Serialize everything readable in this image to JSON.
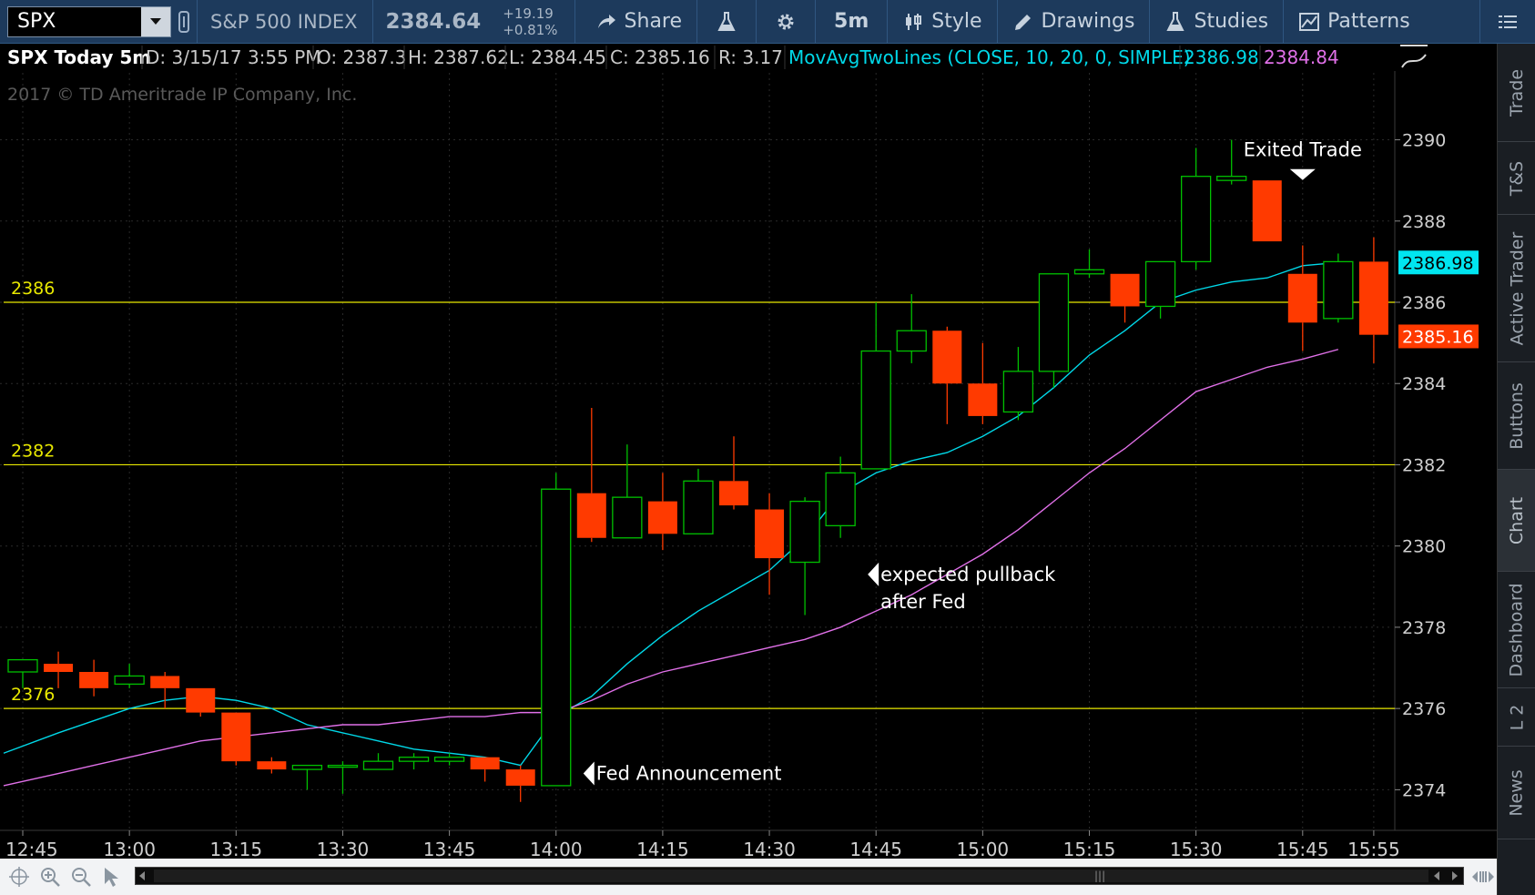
{
  "toolbar": {
    "symbol": "SPX",
    "index_name": "S&P 500 INDEX",
    "last_price": "2384.64",
    "change_points": "+19.19",
    "change_percent": "+0.81%",
    "share_label": "Share",
    "timeframe_label": "5m",
    "style_label": "Style",
    "drawings_label": "Drawings",
    "studies_label": "Studies",
    "patterns_label": "Patterns"
  },
  "header": {
    "title": "SPX Today 5m",
    "date": "D: 3/15/17 3:55 PM",
    "open": "O: 2387.3",
    "high": "H: 2387.62",
    "low": "L: 2384.45",
    "close": "C: 2385.16",
    "range": "R: 3.17",
    "study_label": "MovAvgTwoLines (CLOSE, 10, 20, 0, SIMPLE)",
    "study_value_1": "2386.98",
    "study_value_2": "2384.84",
    "copyright": "2017 © TD Ameritrade IP Company, Inc."
  },
  "side_tabs": [
    "Trade",
    "T&S",
    "Active Trader",
    "Buttons",
    "Chart",
    "Dashboard",
    "L 2",
    "News"
  ],
  "side_tabs_active": "Chart",
  "chart_data": {
    "type": "candlestick",
    "y_range": [
      2373,
      2391.2
    ],
    "y_ticks": [
      2374,
      2376,
      2378,
      2380,
      2382,
      2384,
      2386,
      2388,
      2390
    ],
    "x_ticks": [
      {
        "label": "12:45",
        "bar": 0
      },
      {
        "label": "13:00",
        "bar": 3
      },
      {
        "label": "13:15",
        "bar": 6
      },
      {
        "label": "13:30",
        "bar": 9
      },
      {
        "label": "13:45",
        "bar": 12
      },
      {
        "label": "14:00",
        "bar": 15
      },
      {
        "label": "14:15",
        "bar": 18
      },
      {
        "label": "14:30",
        "bar": 21
      },
      {
        "label": "14:45",
        "bar": 24
      },
      {
        "label": "15:00",
        "bar": 27
      },
      {
        "label": "15:15",
        "bar": 30
      },
      {
        "label": "15:30",
        "bar": 33
      },
      {
        "label": "15:45",
        "bar": 36
      },
      {
        "label": "15:55",
        "bar": 38
      }
    ],
    "candles": [
      {
        "o": 2376.9,
        "h": 2377.2,
        "l": 2376.5,
        "c": 2377.2
      },
      {
        "o": 2377.1,
        "h": 2377.4,
        "l": 2376.5,
        "c": 2376.9
      },
      {
        "o": 2376.9,
        "h": 2377.2,
        "l": 2376.3,
        "c": 2376.5
      },
      {
        "o": 2376.6,
        "h": 2377.1,
        "l": 2376.5,
        "c": 2376.8
      },
      {
        "o": 2376.8,
        "h": 2376.9,
        "l": 2376.0,
        "c": 2376.5
      },
      {
        "o": 2376.5,
        "h": 2376.5,
        "l": 2375.8,
        "c": 2375.9
      },
      {
        "o": 2375.9,
        "h": 2375.9,
        "l": 2374.6,
        "c": 2374.7
      },
      {
        "o": 2374.7,
        "h": 2374.8,
        "l": 2374.4,
        "c": 2374.5
      },
      {
        "o": 2374.5,
        "h": 2374.6,
        "l": 2374.0,
        "c": 2374.6
      },
      {
        "o": 2374.6,
        "h": 2374.7,
        "l": 2373.9,
        "c": 2374.6
      },
      {
        "o": 2374.5,
        "h": 2374.9,
        "l": 2374.5,
        "c": 2374.7
      },
      {
        "o": 2374.7,
        "h": 2374.9,
        "l": 2374.5,
        "c": 2374.8
      },
      {
        "o": 2374.7,
        "h": 2374.9,
        "l": 2374.6,
        "c": 2374.8
      },
      {
        "o": 2374.8,
        "h": 2374.8,
        "l": 2374.2,
        "c": 2374.5
      },
      {
        "o": 2374.5,
        "h": 2374.6,
        "l": 2373.7,
        "c": 2374.1
      },
      {
        "o": 2374.1,
        "h": 2381.8,
        "l": 2374.1,
        "c": 2381.4
      },
      {
        "o": 2381.3,
        "h": 2383.4,
        "l": 2380.1,
        "c": 2380.2
      },
      {
        "o": 2380.2,
        "h": 2382.5,
        "l": 2380.2,
        "c": 2381.2
      },
      {
        "o": 2381.1,
        "h": 2381.8,
        "l": 2379.9,
        "c": 2380.3
      },
      {
        "o": 2380.3,
        "h": 2381.9,
        "l": 2380.3,
        "c": 2381.6
      },
      {
        "o": 2381.6,
        "h": 2382.7,
        "l": 2380.9,
        "c": 2381.0
      },
      {
        "o": 2380.9,
        "h": 2381.3,
        "l": 2378.8,
        "c": 2379.7
      },
      {
        "o": 2379.6,
        "h": 2381.2,
        "l": 2378.3,
        "c": 2381.1
      },
      {
        "o": 2380.5,
        "h": 2382.2,
        "l": 2380.2,
        "c": 2381.8
      },
      {
        "o": 2381.9,
        "h": 2386.0,
        "l": 2381.9,
        "c": 2384.8
      },
      {
        "o": 2384.8,
        "h": 2386.2,
        "l": 2384.5,
        "c": 2385.3
      },
      {
        "o": 2385.3,
        "h": 2385.4,
        "l": 2383.0,
        "c": 2384.0
      },
      {
        "o": 2384.0,
        "h": 2385.0,
        "l": 2383.0,
        "c": 2383.2
      },
      {
        "o": 2383.3,
        "h": 2384.9,
        "l": 2383.1,
        "c": 2384.3
      },
      {
        "o": 2384.3,
        "h": 2386.7,
        "l": 2383.9,
        "c": 2386.7
      },
      {
        "o": 2386.7,
        "h": 2387.3,
        "l": 2386.6,
        "c": 2386.8
      },
      {
        "o": 2386.7,
        "h": 2386.7,
        "l": 2385.5,
        "c": 2385.9
      },
      {
        "o": 2385.9,
        "h": 2387.0,
        "l": 2385.6,
        "c": 2387.0
      },
      {
        "o": 2387.0,
        "h": 2389.8,
        "l": 2386.8,
        "c": 2389.1
      },
      {
        "o": 2389.0,
        "h": 2390.0,
        "l": 2388.9,
        "c": 2389.1
      },
      {
        "o": 2389.0,
        "h": 2389.0,
        "l": 2387.5,
        "c": 2387.5
      },
      {
        "o": 2386.7,
        "h": 2387.4,
        "l": 2384.8,
        "c": 2385.5
      },
      {
        "o": 2385.6,
        "h": 2387.2,
        "l": 2385.5,
        "c": 2387.0
      },
      {
        "o": 2387.0,
        "h": 2387.6,
        "l": 2384.5,
        "c": 2385.2
      }
    ],
    "series": [
      {
        "name": "MovAvg 10",
        "color": "#00d8e8",
        "values": [
          2374.9,
          2375.4,
          2375.7,
          2376.0,
          2376.2,
          2376.3,
          2376.2,
          2376.0,
          2375.6,
          2375.4,
          2375.2,
          2375.0,
          2374.9,
          2374.8,
          2374.6,
          2375.8,
          2376.3,
          2377.1,
          2377.8,
          2378.4,
          2378.9,
          2379.4,
          2380.2,
          2381.3,
          2381.8,
          2382.1,
          2382.3,
          2382.7,
          2383.2,
          2383.9,
          2384.7,
          2385.3,
          2386.0,
          2386.3,
          2386.5,
          2386.6,
          2386.9,
          2386.98
        ]
      },
      {
        "name": "MovAvg 20",
        "color": "#e070e8",
        "values": [
          2374.1,
          2374.4,
          2374.6,
          2374.8,
          2375.0,
          2375.2,
          2375.3,
          2375.4,
          2375.5,
          2375.6,
          2375.6,
          2375.7,
          2375.8,
          2375.8,
          2375.9,
          2375.9,
          2376.2,
          2376.6,
          2376.9,
          2377.1,
          2377.3,
          2377.5,
          2377.7,
          2378.0,
          2378.4,
          2378.8,
          2379.3,
          2379.8,
          2380.4,
          2381.1,
          2381.8,
          2382.4,
          2383.1,
          2383.8,
          2384.1,
          2384.4,
          2384.6,
          2384.84
        ]
      }
    ],
    "hlines": [
      {
        "label": "2386",
        "value": 2386.0,
        "color": "#e8e800"
      },
      {
        "label": "2382",
        "value": 2382.0,
        "color": "#e8e800"
      },
      {
        "label": "2376",
        "value": 2376.0,
        "color": "#e8e800"
      }
    ],
    "price_bubbles": [
      {
        "label": "2386.98",
        "value": 2386.98,
        "bg": "#00e5f0",
        "fg": "#000000"
      },
      {
        "label": "2385.16",
        "value": 2385.16,
        "bg": "#ff3a00",
        "fg": "#ffffff"
      }
    ],
    "annotations": [
      {
        "text": "Fed Announcement",
        "bar": 15,
        "value": 2374.4,
        "arrow": "left"
      },
      {
        "text": "expected pullback",
        "text2": "after Fed",
        "bar": 23,
        "value": 2379.3,
        "arrow": "left"
      },
      {
        "text": "Exited Trade",
        "bar": 36,
        "value": 2389.1,
        "arrow": "down"
      }
    ],
    "colors": {
      "up": "#00c000",
      "down": "#ff3a00",
      "grid": "#2a2a2a",
      "text": "#cfcfcf"
    }
  }
}
